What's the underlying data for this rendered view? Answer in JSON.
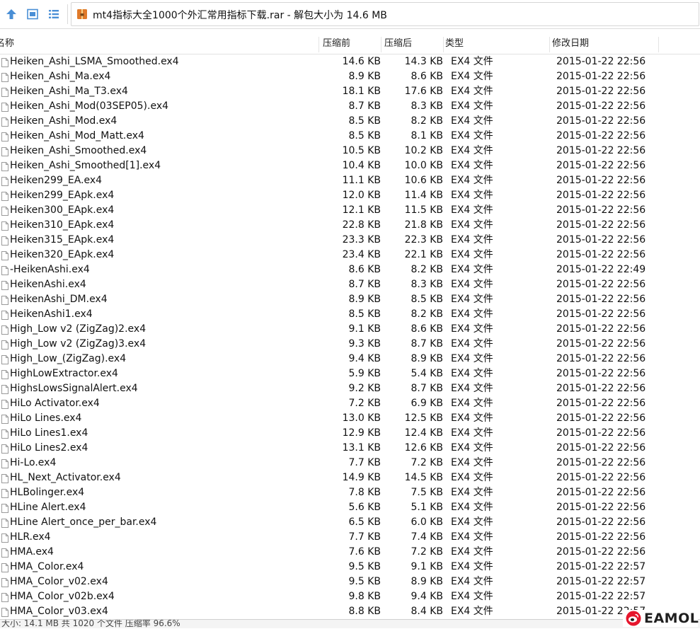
{
  "toolbar": {
    "title": "mt4指标大全1000个外汇常用指标下载.rar - 解包大小为 14.6 MB",
    "icons": [
      "up-arrow-icon",
      "view-panel-icon",
      "list-view-icon",
      "archive-icon"
    ],
    "colors": {
      "up_arrow": "#4a8fd6",
      "archive_icon": "#e07a2a"
    }
  },
  "columns": {
    "name": "名称",
    "original": "压缩前",
    "compressed": "压缩后",
    "type": "类型",
    "modified": "修改日期"
  },
  "files": [
    {
      "name": "Heiken_Ashi_LSMA_Smoothed.ex4",
      "original": "14.6 KB",
      "compressed": "14.3 KB",
      "type": "EX4 文件",
      "modified": "2015-01-22 22:56"
    },
    {
      "name": "Heiken_Ashi_Ma.ex4",
      "original": "8.9 KB",
      "compressed": "8.6 KB",
      "type": "EX4 文件",
      "modified": "2015-01-22 22:56"
    },
    {
      "name": "Heiken_Ashi_Ma_T3.ex4",
      "original": "18.1 KB",
      "compressed": "17.6 KB",
      "type": "EX4 文件",
      "modified": "2015-01-22 22:56"
    },
    {
      "name": "Heiken_Ashi_Mod(03SEP05).ex4",
      "original": "8.7 KB",
      "compressed": "8.3 KB",
      "type": "EX4 文件",
      "modified": "2015-01-22 22:56"
    },
    {
      "name": "Heiken_Ashi_Mod.ex4",
      "original": "8.5 KB",
      "compressed": "8.2 KB",
      "type": "EX4 文件",
      "modified": "2015-01-22 22:56"
    },
    {
      "name": "Heiken_Ashi_Mod_Matt.ex4",
      "original": "8.5 KB",
      "compressed": "8.1 KB",
      "type": "EX4 文件",
      "modified": "2015-01-22 22:56"
    },
    {
      "name": "Heiken_Ashi_Smoothed.ex4",
      "original": "10.5 KB",
      "compressed": "10.2 KB",
      "type": "EX4 文件",
      "modified": "2015-01-22 22:56"
    },
    {
      "name": "Heiken_Ashi_Smoothed[1].ex4",
      "original": "10.4 KB",
      "compressed": "10.0 KB",
      "type": "EX4 文件",
      "modified": "2015-01-22 22:56"
    },
    {
      "name": "Heiken299_EA.ex4",
      "original": "11.1 KB",
      "compressed": "10.6 KB",
      "type": "EX4 文件",
      "modified": "2015-01-22 22:56"
    },
    {
      "name": "Heiken299_EApk.ex4",
      "original": "12.0 KB",
      "compressed": "11.4 KB",
      "type": "EX4 文件",
      "modified": "2015-01-22 22:56"
    },
    {
      "name": "Heiken300_EApk.ex4",
      "original": "12.1 KB",
      "compressed": "11.5 KB",
      "type": "EX4 文件",
      "modified": "2015-01-22 22:56"
    },
    {
      "name": "Heiken310_EApk.ex4",
      "original": "22.8 KB",
      "compressed": "21.8 KB",
      "type": "EX4 文件",
      "modified": "2015-01-22 22:56"
    },
    {
      "name": "Heiken315_EApk.ex4",
      "original": "23.3 KB",
      "compressed": "22.3 KB",
      "type": "EX4 文件",
      "modified": "2015-01-22 22:56"
    },
    {
      "name": "Heiken320_EApk.ex4",
      "original": "23.4 KB",
      "compressed": "22.1 KB",
      "type": "EX4 文件",
      "modified": "2015-01-22 22:56"
    },
    {
      "name": "-HeikenAshi.ex4",
      "original": "8.6 KB",
      "compressed": "8.2 KB",
      "type": "EX4 文件",
      "modified": "2015-01-22 22:49"
    },
    {
      "name": "HeikenAshi.ex4",
      "original": "8.7 KB",
      "compressed": "8.3 KB",
      "type": "EX4 文件",
      "modified": "2015-01-22 22:56"
    },
    {
      "name": "HeikenAshi_DM.ex4",
      "original": "8.9 KB",
      "compressed": "8.5 KB",
      "type": "EX4 文件",
      "modified": "2015-01-22 22:56"
    },
    {
      "name": "HeikenAshi1.ex4",
      "original": "8.5 KB",
      "compressed": "8.2 KB",
      "type": "EX4 文件",
      "modified": "2015-01-22 22:56"
    },
    {
      "name": "High_Low v2 (ZigZag)2.ex4",
      "original": "9.1 KB",
      "compressed": "8.6 KB",
      "type": "EX4 文件",
      "modified": "2015-01-22 22:56"
    },
    {
      "name": "High_Low v2 (ZigZag)3.ex4",
      "original": "9.3 KB",
      "compressed": "8.7 KB",
      "type": "EX4 文件",
      "modified": "2015-01-22 22:56"
    },
    {
      "name": "High_Low_(ZigZag).ex4",
      "original": "9.4 KB",
      "compressed": "8.9 KB",
      "type": "EX4 文件",
      "modified": "2015-01-22 22:56"
    },
    {
      "name": "HighLowExtractor.ex4",
      "original": "5.9 KB",
      "compressed": "5.4 KB",
      "type": "EX4 文件",
      "modified": "2015-01-22 22:56"
    },
    {
      "name": "HighsLowsSignalAlert.ex4",
      "original": "9.2 KB",
      "compressed": "8.7 KB",
      "type": "EX4 文件",
      "modified": "2015-01-22 22:56"
    },
    {
      "name": "HiLo Activator.ex4",
      "original": "7.2 KB",
      "compressed": "6.9 KB",
      "type": "EX4 文件",
      "modified": "2015-01-22 22:56"
    },
    {
      "name": "HiLo Lines.ex4",
      "original": "13.0 KB",
      "compressed": "12.5 KB",
      "type": "EX4 文件",
      "modified": "2015-01-22 22:56"
    },
    {
      "name": "HiLo Lines1.ex4",
      "original": "12.9 KB",
      "compressed": "12.4 KB",
      "type": "EX4 文件",
      "modified": "2015-01-22 22:56"
    },
    {
      "name": "HiLo Lines2.ex4",
      "original": "13.1 KB",
      "compressed": "12.6 KB",
      "type": "EX4 文件",
      "modified": "2015-01-22 22:56"
    },
    {
      "name": "Hi-Lo.ex4",
      "original": "7.7 KB",
      "compressed": "7.2 KB",
      "type": "EX4 文件",
      "modified": "2015-01-22 22:56"
    },
    {
      "name": "HL_Next_Activator.ex4",
      "original": "14.9 KB",
      "compressed": "14.5 KB",
      "type": "EX4 文件",
      "modified": "2015-01-22 22:56"
    },
    {
      "name": "HLBolinger.ex4",
      "original": "7.8 KB",
      "compressed": "7.5 KB",
      "type": "EX4 文件",
      "modified": "2015-01-22 22:56"
    },
    {
      "name": "HLine Alert.ex4",
      "original": "5.6 KB",
      "compressed": "5.1 KB",
      "type": "EX4 文件",
      "modified": "2015-01-22 22:56"
    },
    {
      "name": "HLine Alert_once_per_bar.ex4",
      "original": "6.5 KB",
      "compressed": "6.0 KB",
      "type": "EX4 文件",
      "modified": "2015-01-22 22:56"
    },
    {
      "name": "HLR.ex4",
      "original": "7.7 KB",
      "compressed": "7.4 KB",
      "type": "EX4 文件",
      "modified": "2015-01-22 22:56"
    },
    {
      "name": "HMA.ex4",
      "original": "7.6 KB",
      "compressed": "7.2 KB",
      "type": "EX4 文件",
      "modified": "2015-01-22 22:56"
    },
    {
      "name": "HMA_Color.ex4",
      "original": "9.5 KB",
      "compressed": "9.1 KB",
      "type": "EX4 文件",
      "modified": "2015-01-22 22:57"
    },
    {
      "name": "HMA_Color_v02.ex4",
      "original": "9.5 KB",
      "compressed": "8.9 KB",
      "type": "EX4 文件",
      "modified": "2015-01-22 22:57"
    },
    {
      "name": "HMA_Color_v02b.ex4",
      "original": "9.8 KB",
      "compressed": "9.4 KB",
      "type": "EX4 文件",
      "modified": "2015-01-22 22:57"
    },
    {
      "name": "HMA_Color_v03.ex4",
      "original": "8.8 KB",
      "compressed": "8.4 KB",
      "type": "EX4 文件",
      "modified": "2015-01-22 22:57"
    }
  ],
  "status": {
    "text": "大小: 14.1 MB 共 1020 个文件 压缩率 96.6%"
  },
  "watermark": {
    "text": "EAMOL",
    "icon": "weibo-logo-icon",
    "color": "#e6162d"
  }
}
